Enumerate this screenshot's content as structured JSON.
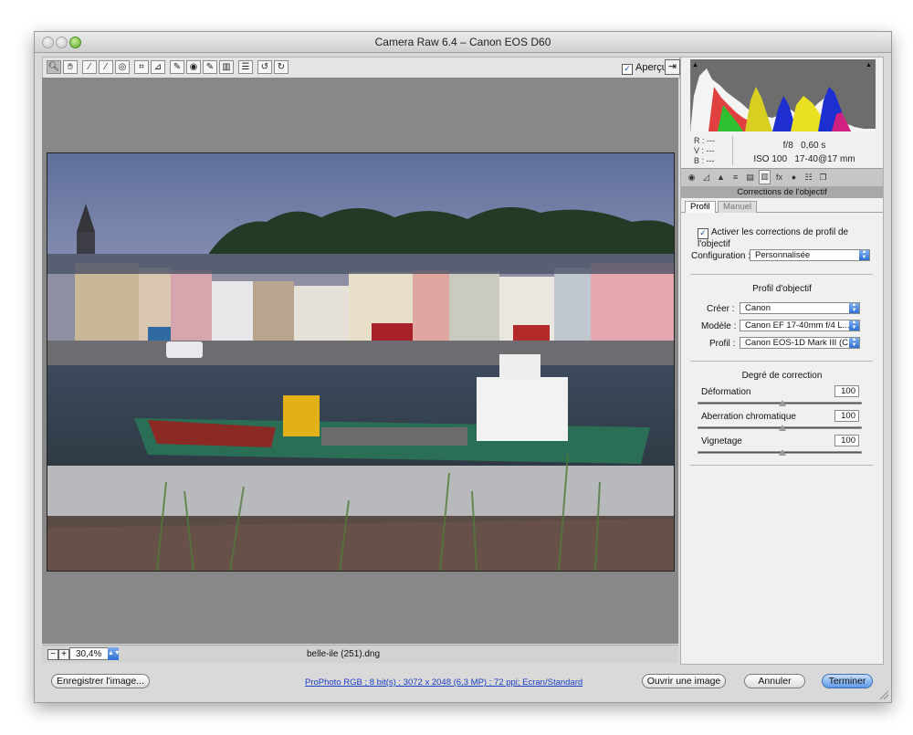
{
  "window": {
    "title": "Camera Raw 6.4  –  Canon EOS D60"
  },
  "toolbar": {
    "tools": [
      {
        "name": "zoom-tool",
        "glyph": "🔍︎",
        "active": true
      },
      {
        "name": "hand-tool",
        "glyph": "✋︎"
      },
      {
        "name": "white-balance-tool",
        "glyph": "⁄"
      },
      {
        "name": "color-sampler-tool",
        "glyph": "⁄"
      },
      {
        "name": "targeted-adjustment-tool",
        "glyph": "◎"
      },
      {
        "name": "crop-tool",
        "glyph": "⌗"
      },
      {
        "name": "straighten-tool",
        "glyph": "⊿"
      },
      {
        "name": "spot-removal-tool",
        "glyph": "✎"
      },
      {
        "name": "red-eye-tool",
        "glyph": "◉"
      },
      {
        "name": "adjustment-brush-tool",
        "glyph": "✎"
      },
      {
        "name": "graduated-filter-tool",
        "glyph": "▥"
      },
      {
        "name": "preferences-tool",
        "glyph": "☰"
      },
      {
        "name": "rotate-ccw-tool",
        "glyph": "↺"
      },
      {
        "name": "rotate-cw-tool",
        "glyph": "↻"
      }
    ],
    "preview_label": "Aperçu",
    "preview_checked": true
  },
  "status": {
    "zoom": "30,4%",
    "filename": "belle-ile (251).dng"
  },
  "info": {
    "r_label": "R :",
    "r_value": "---",
    "v_label": "V :",
    "v_value": "---",
    "b_label": "B :",
    "b_value": "---",
    "aperture": "f/8",
    "shutter": "0,60 s",
    "iso": "ISO 100",
    "lens": "17-40@17 mm"
  },
  "panel": {
    "title": "Corrections de l'objectif",
    "tabs": [
      "Profil",
      "Manuel"
    ],
    "enable_label": "Activer les corrections de profil de l'objectif",
    "enable_checked": true,
    "config_label": "Configuration :",
    "config_value": "Personnalisée",
    "lens_profile_header": "Profil d'objectif",
    "maker_label": "Créer :",
    "maker_value": "Canon",
    "model_label": "Modèle :",
    "model_value": "Canon EF 17-40mm f/4 L...",
    "profile_label": "Profil :",
    "profile_value": "Canon EOS-1D Mark III (C...",
    "amount_header": "Degré de correction",
    "sliders": [
      {
        "label": "Déformation",
        "value": "100"
      },
      {
        "label": "Aberration chromatique",
        "value": "100"
      },
      {
        "label": "Vignetage",
        "value": "100"
      }
    ]
  },
  "footer": {
    "save_label": "Enregistrer l'image...",
    "info_link": "ProPhoto RGB ; 8 bit(s) ; 3072 x 2048 (6,3 MP) ; 72 ppi; Ecran/Standard",
    "open_label": "Ouvrir une image",
    "cancel_label": "Annuler",
    "done_label": "Terminer"
  },
  "colors": {
    "accent": "#5d9ae6",
    "window_bg": "#d9d9d9",
    "canvas_bg": "#888888"
  }
}
